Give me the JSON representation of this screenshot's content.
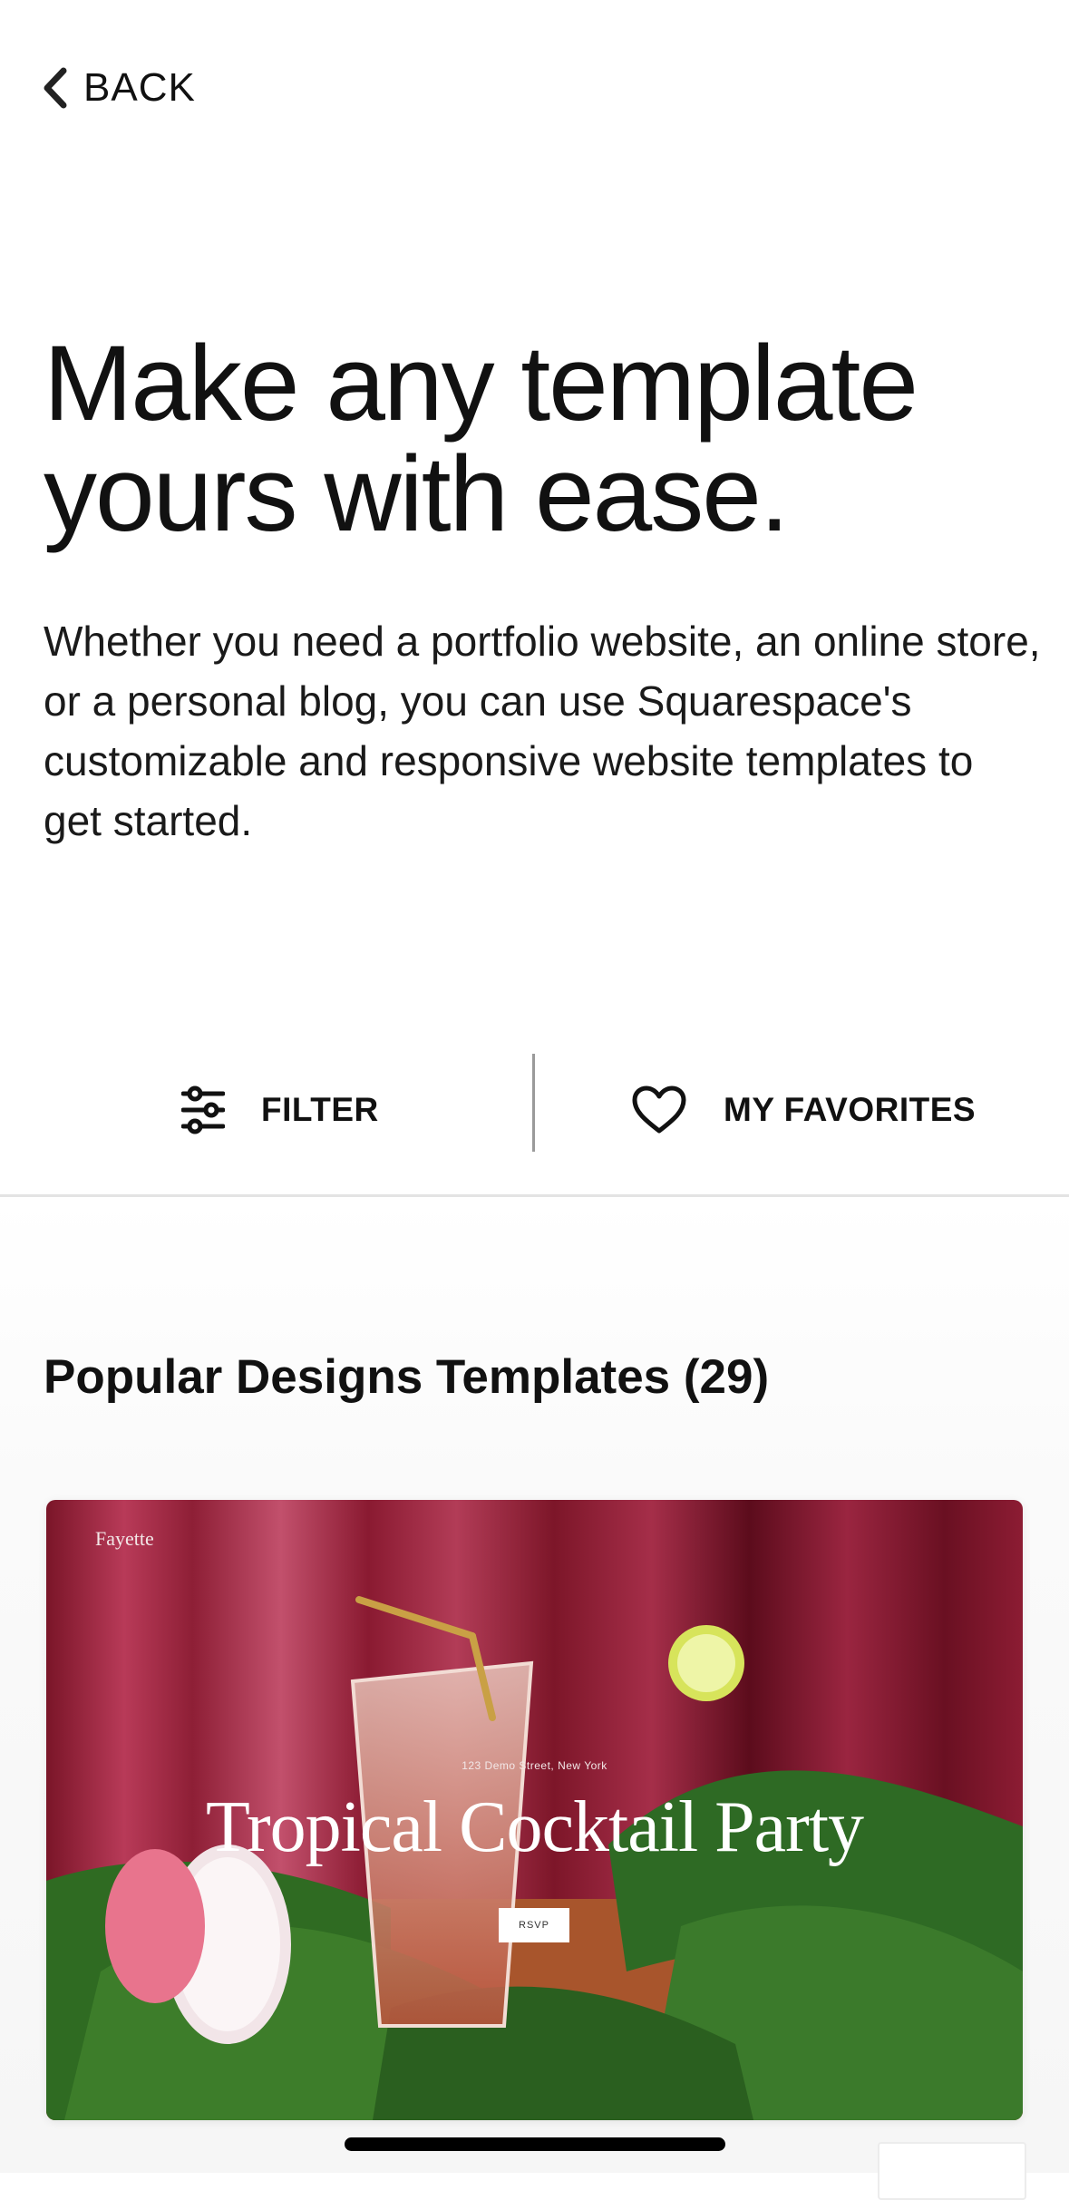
{
  "nav": {
    "back_label": "BACK"
  },
  "hero": {
    "title_line1": "Make any template",
    "title_line2": "yours with ease.",
    "description": "Whether you need a portfolio website, an online store, or a personal blog, you can use Squarespace's customizable and responsive website templates to get started."
  },
  "actions": {
    "filter_label": "FILTER",
    "favorites_label": "MY FAVORITES"
  },
  "section": {
    "title": "Popular Designs Templates (29)"
  },
  "template_card": {
    "brand": "Fayette",
    "address": "123 Demo Street, New York",
    "headline": "Tropical Cocktail Party",
    "rsvp_label": "RSVP"
  },
  "icons": {
    "back": "chevron-left-icon",
    "filter": "sliders-icon",
    "favorites": "heart-outline-icon"
  },
  "colors": {
    "text": "#111111",
    "card_background": "#8e1f33",
    "divider": "#e3e3e3"
  }
}
